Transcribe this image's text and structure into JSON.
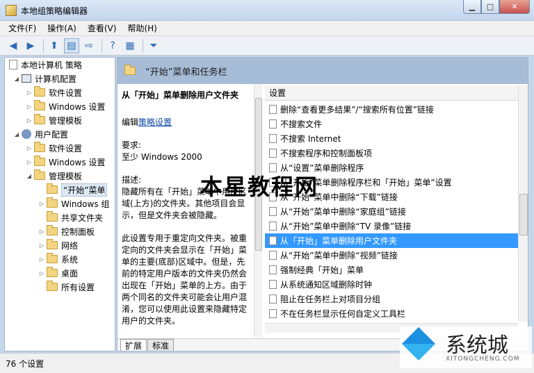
{
  "window": {
    "title": "本地组策略编辑器",
    "controls": {
      "minimize": "▁",
      "maximize": "□",
      "close": "✕"
    }
  },
  "menu": [
    "文件(F)",
    "操作(A)",
    "查看(V)",
    "帮助(H)"
  ],
  "tree": {
    "root": "本地计算机 策略",
    "computer_config": "计算机配置",
    "computer_children": [
      "软件设置",
      "Windows 设置",
      "管理模板"
    ],
    "user_config": "用户配置",
    "user_children": [
      "软件设置",
      "Windows 设置",
      "管理模板"
    ],
    "admin_template_children": [
      "“开始”菜单",
      "Windows 组",
      "共享文件夹",
      "控制面板",
      "网络",
      "系统",
      "桌面",
      "所有设置"
    ]
  },
  "content": {
    "header_title": "“开始”菜单和任务栏",
    "desc_title": "从「开始」菜单删除用户文件夹",
    "edit_prefix": "编辑",
    "edit_link": "策略设置",
    "requirement_label": "要求:",
    "requirement_value": "至少 Windows 2000",
    "description_label": "描述:",
    "description_text": "隐藏所有在「开始」菜单中用户区域(上方)的文件夹。其他项目会显示，但是文件夹会被隐藏。",
    "description_more": "此设置专用于重定向文件夹。被重定向的文件夹会显示在「开始」菜单的主要(底部)区域中。但是，先前的特定用户版本的文件夹仍然会出现在「开始」菜单的上方。由于两个同名的文件夹可能会让用户混淆，您可以使用此设置来隐藏特定用户的文件夹。",
    "list_header": "设置",
    "list_items": [
      "删除“查看更多结果”/“搜索所有位置”链接",
      "不搜索文件",
      "不搜索 Internet",
      "不搜索程序和控制面板项",
      "从“设置”菜单删除程序",
      "从“开始”菜单删除程序栏和「开始」菜单”设置",
      "从“开始”菜单中删除“下载”链接",
      "从“开始”菜单中删除“家庭组”链接",
      "从“开始”菜单中删除“TV 录像”链接",
      "从「开始」菜单删除用户文件夹",
      "从“开始”菜单中删除“视频”链接",
      "强制经典「开始」菜单",
      "从系统通知区域删除时钟",
      "阻止在任务栏上对项目分组",
      "不在任务栏显示任何自定义工具栏"
    ],
    "selected_index": 9,
    "tabs": [
      "扩展",
      "标准"
    ]
  },
  "status": "76 个设置",
  "watermarks": {
    "center": "本星教程网",
    "corner": "系统城",
    "corner_sub": "XITONGCHENG.COM"
  }
}
